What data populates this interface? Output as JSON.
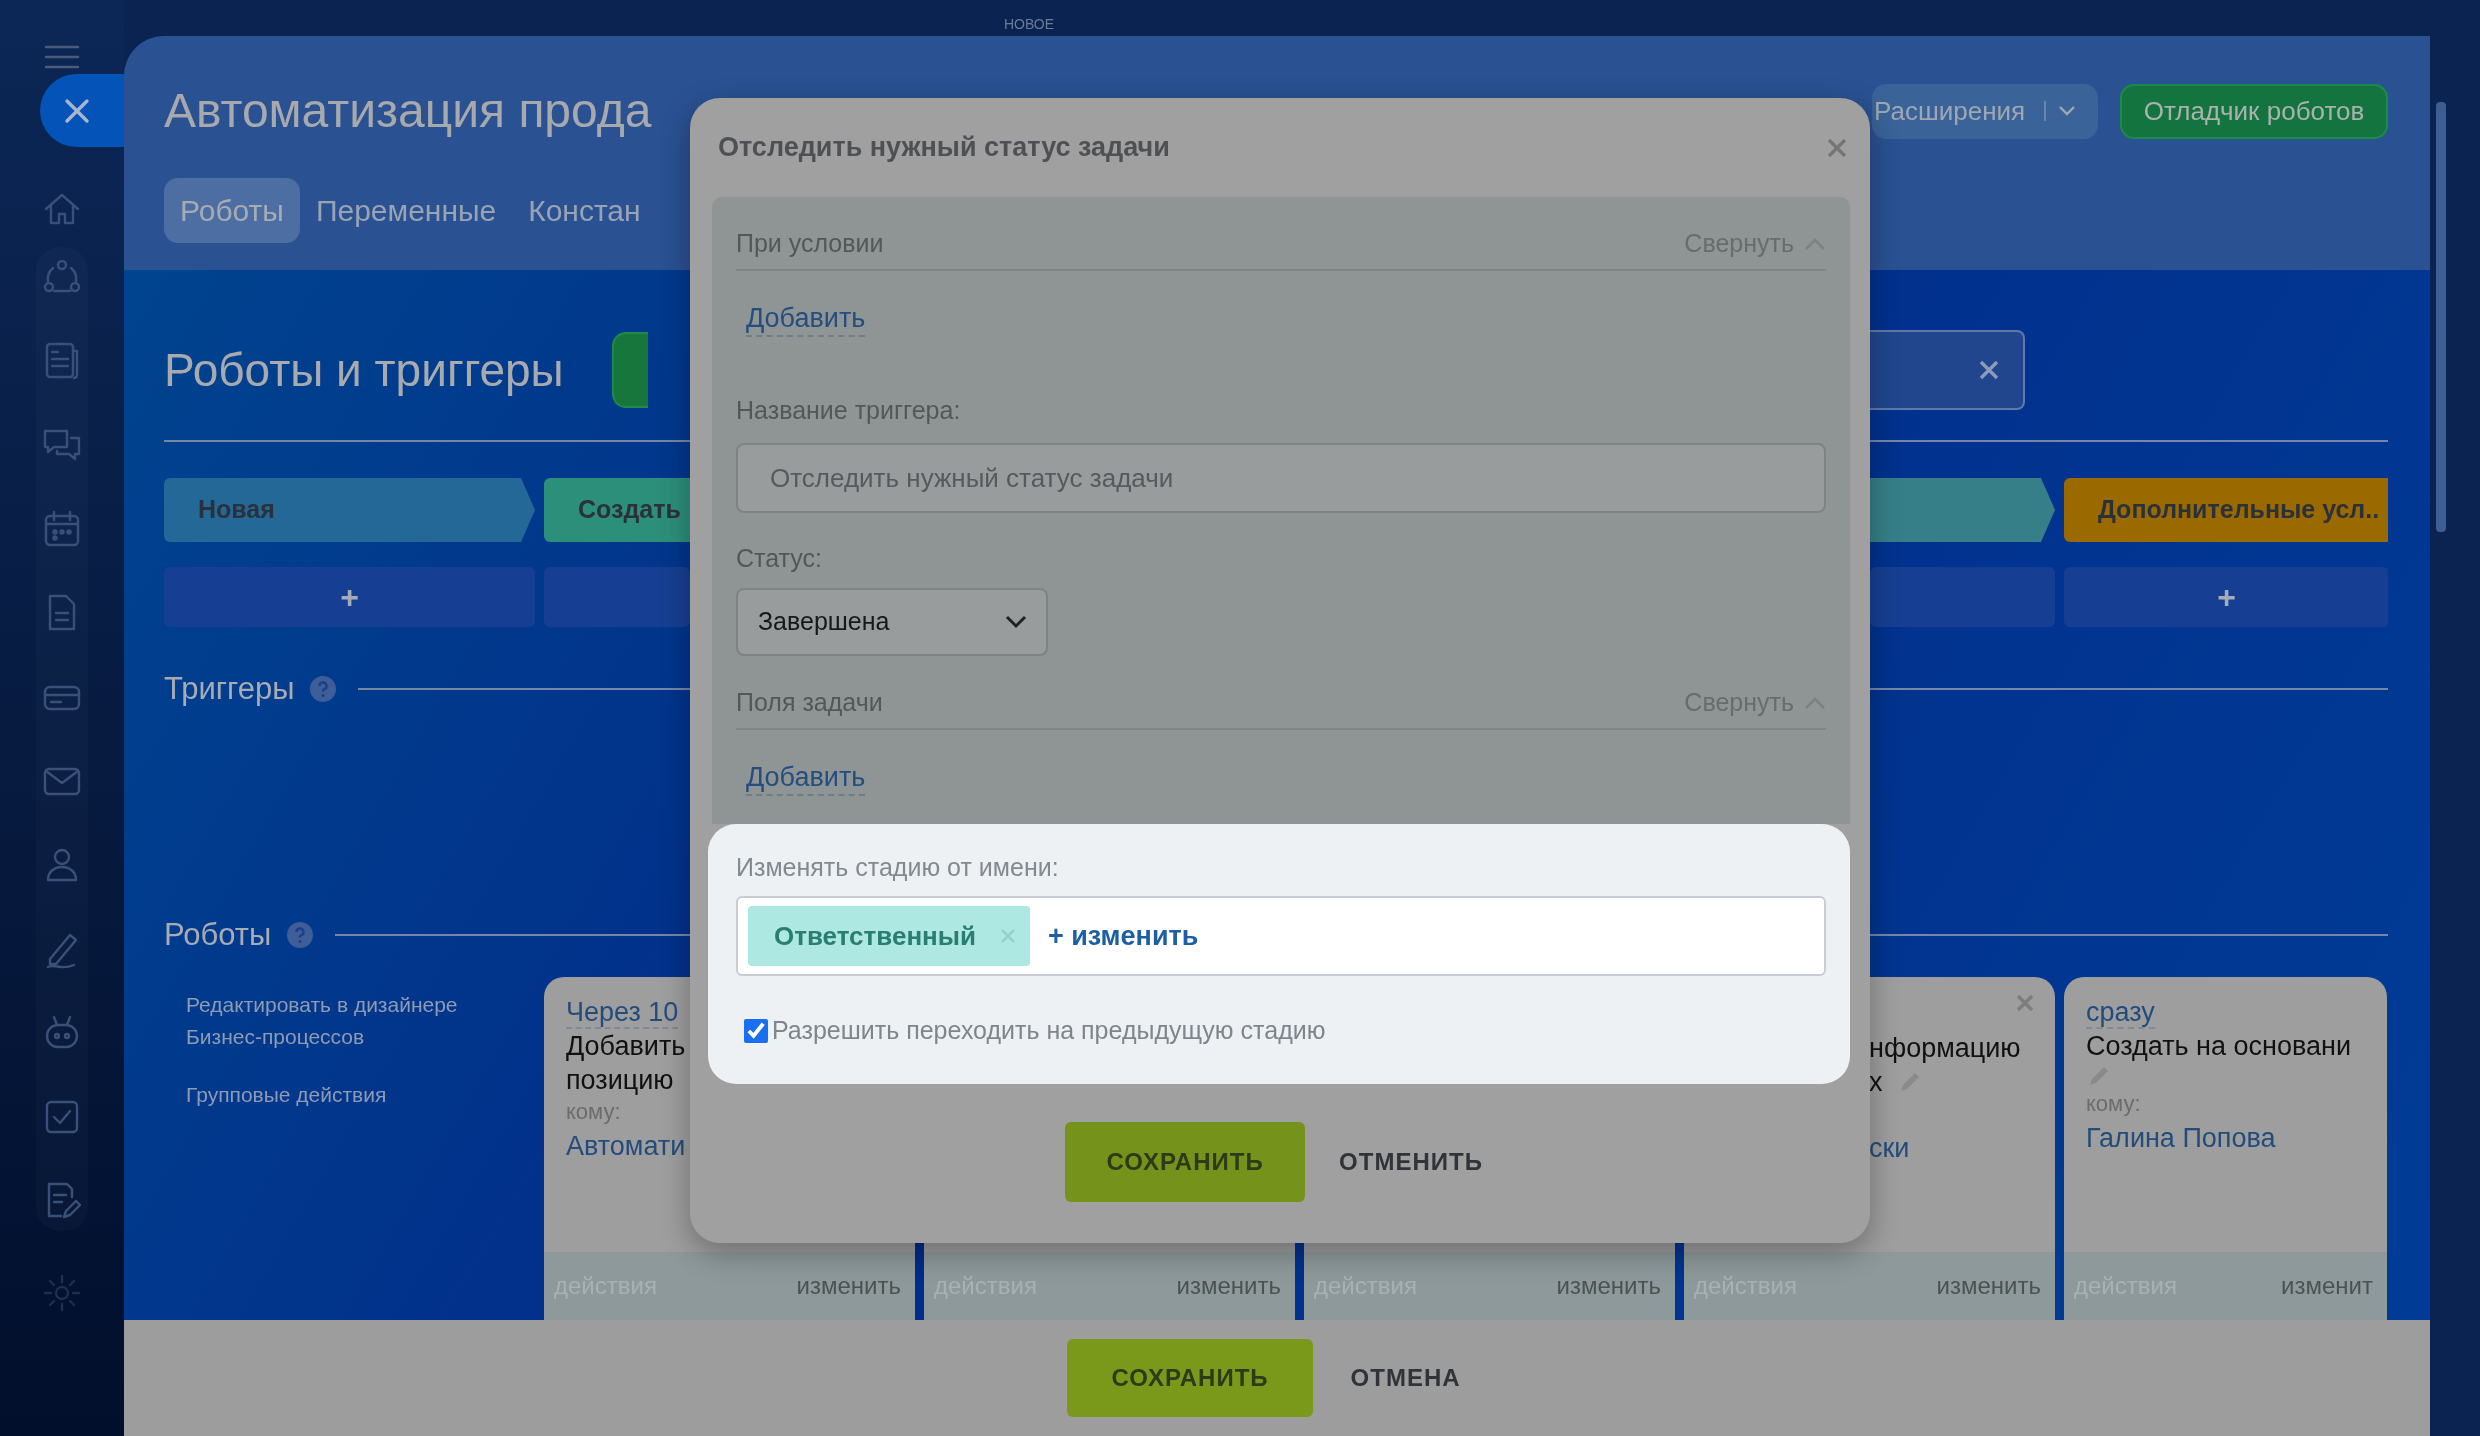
{
  "top_label": "НОВОЕ",
  "header": {
    "title": "Автоматизация прода",
    "tabs": [
      {
        "label": "Роботы",
        "selected": true
      },
      {
        "label": "Переменные",
        "selected": false
      },
      {
        "label": "Констан",
        "selected": false
      }
    ],
    "extensions_button": "Расширения",
    "debugger_button": "Отладчик роботов"
  },
  "main": {
    "title": "Роботы и триггеры",
    "stages": [
      {
        "label": "Новая",
        "color": "#246898"
      },
      {
        "label": "Создать",
        "color": "#2c8f7a"
      },
      {
        "color": "#367f88"
      },
      {
        "label": "Дополнительные усл..",
        "color": "#9a6a00"
      }
    ],
    "stage_add": [
      {
        "kind": "plus",
        "label": "+"
      },
      {
        "kind": "blank"
      },
      {
        "kind": "blank"
      },
      {
        "kind": "plus",
        "label": "+"
      }
    ],
    "triggers_heading": "Триггеры",
    "robots_heading": "Роботы",
    "robot_links": [
      "Редактировать в дизайнере Бизнес-процессов",
      "Групповые действия"
    ],
    "robot_cards": [
      {
        "delay": "Через 10",
        "lines": [
          "Добавить",
          "позицию"
        ],
        "to_label": "кому:",
        "assignee": "Автомати",
        "footer_action": "действия",
        "footer_edit": "изменить"
      },
      {
        "footer_action": "действия",
        "footer_edit": "изменить"
      },
      {
        "footer_action": "действия",
        "footer_edit": "изменить"
      },
      {
        "closable": true,
        "lines": [
          "нформацию",
          "х"
        ],
        "editable": true,
        "assignee": "ски",
        "footer_action": "действия",
        "footer_edit": "изменить"
      },
      {
        "delay": "сразу",
        "lines": [
          "Создать на основани"
        ],
        "editable": true,
        "to_label": "кому:",
        "assignee": "Галина Попова",
        "footer_action": "действия",
        "footer_edit": "изменит"
      }
    ]
  },
  "bottom_bar": {
    "save": "СОХРАНИТЬ",
    "cancel": "ОТМЕНА"
  },
  "modal": {
    "title": "Отследить нужный статус задачи",
    "condition_section": {
      "title": "При условии",
      "toggle": "Свернуть",
      "expanded": true,
      "add_link": "Добавить"
    },
    "name_field": {
      "label": "Название триггера:",
      "value": "Отследить нужный статус задачи"
    },
    "status_field": {
      "label": "Статус:",
      "value": "Завершена"
    },
    "fields_section": {
      "title": "Поля задачи",
      "toggle": "Свернуть",
      "expanded": true,
      "add_link": "Добавить"
    },
    "stage_from": {
      "label": "Изменять стадию от имени:",
      "chips": [
        {
          "label": "Ответственный"
        }
      ],
      "change_link": "+ изменить",
      "allow_previous": {
        "label": "Разрешить переходить на предыдущую стадию",
        "checked": true
      }
    },
    "buttons": {
      "save": "СОХРАНИТЬ",
      "cancel": "ОТМЕНИТЬ"
    }
  }
}
